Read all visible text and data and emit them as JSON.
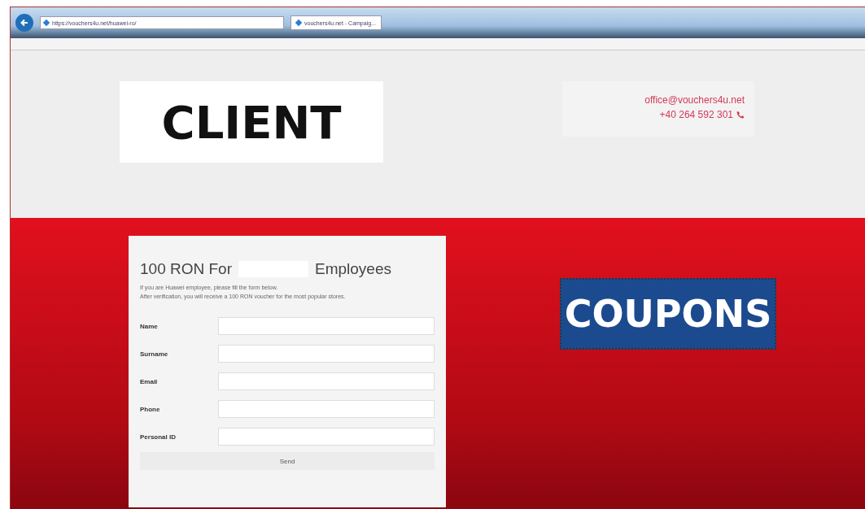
{
  "browser": {
    "address": "https://vouchers4u.net/huawei-ro/",
    "tab": {
      "label": "vouchers4u.net - Campaig...",
      "selected": true
    }
  },
  "header": {
    "logo": "CLIENT",
    "email": "office@vouchers4u.net",
    "phone": "+40 264 592 301"
  },
  "form": {
    "title_start": "100 RON For",
    "title_end": "Employees",
    "lines": [
      "If you are Huawei employee, please fill the form below.",
      "After verification, you will receive a 100 RON voucher for the most popular stores."
    ],
    "fields": [
      {
        "label": "Name"
      },
      {
        "label": "Surname"
      },
      {
        "label": "Email"
      },
      {
        "label": "Phone"
      },
      {
        "label": "Personal ID"
      }
    ],
    "button": "Send"
  },
  "banner": "COUPONS"
}
